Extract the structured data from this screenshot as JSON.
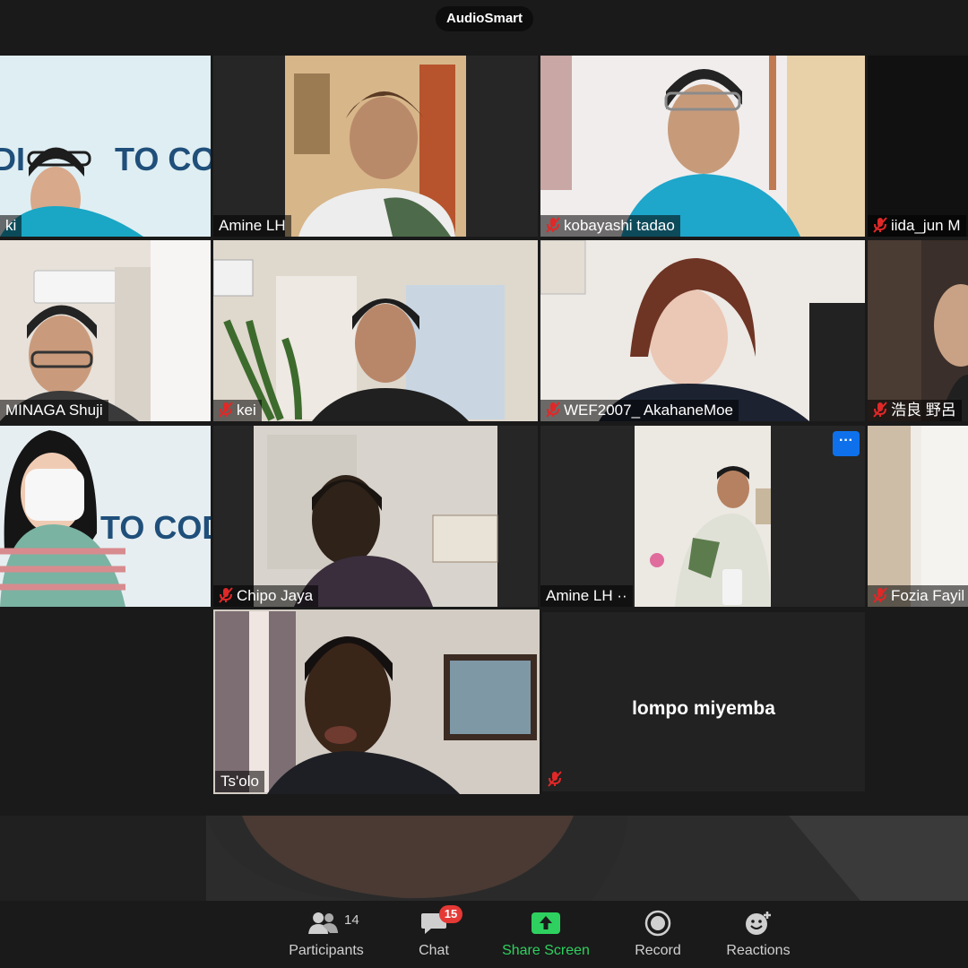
{
  "app_title": "AudioSmart",
  "colors": {
    "background": "#1a1a1a",
    "active_speaker_border": "#c5e86c",
    "mute_red": "#e02828",
    "share_green": "#2ed15f",
    "badge_red": "#e53935",
    "more_blue": "#0e71eb"
  },
  "participants": [
    {
      "name": "ki",
      "muted": false
    },
    {
      "name": "Amine LH",
      "muted": false
    },
    {
      "name": "kobayashi tadao",
      "muted": true
    },
    {
      "name": "iida_jun M",
      "muted": true
    },
    {
      "name": "MINAGA Shuji",
      "muted": false
    },
    {
      "name": "kei",
      "muted": true
    },
    {
      "name": "WEF2007_ AkahaneMoe",
      "muted": true
    },
    {
      "name": "浩良 野呂",
      "muted": true
    },
    {
      "name": "",
      "muted": false
    },
    {
      "name": "Chipo Jaya",
      "muted": true
    },
    {
      "name": "Amine LH ··",
      "muted": false
    },
    {
      "name": "Fozia Fayil",
      "muted": true
    },
    {
      "name": "Ts'olo",
      "muted": false,
      "active_speaker": true
    },
    {
      "name": "lompo miyemba",
      "muted": true,
      "video_off": true
    }
  ],
  "more_button": "···",
  "toolbar": {
    "participants": {
      "label": "Participants",
      "count": "14",
      "icon": "participants-icon"
    },
    "chat": {
      "label": "Chat",
      "badge": "15",
      "icon": "chat-icon"
    },
    "share": {
      "label": "Share Screen",
      "icon": "share-screen-icon"
    },
    "record": {
      "label": "Record",
      "icon": "record-icon"
    },
    "reactions": {
      "label": "Reactions",
      "icon": "reactions-icon"
    }
  }
}
